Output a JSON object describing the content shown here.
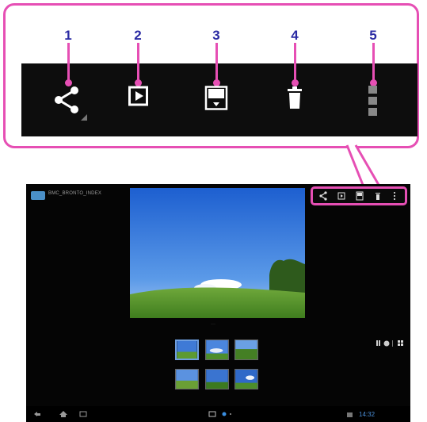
{
  "callout": {
    "numbers": [
      "1",
      "2",
      "3",
      "4",
      "5"
    ],
    "highlight_color": "#e64fb4",
    "number_color": "#2a2aa3"
  },
  "action_bar": {
    "icons": [
      "share-icon",
      "slideshow-play-icon",
      "display-select-icon",
      "delete-icon",
      "overflow-menu-icon"
    ]
  },
  "app": {
    "title": "BMC_BRONTO_INDEX",
    "logo_color": "#4a8fc7"
  },
  "thumbnails": {
    "count": 6,
    "selected_index": 0
  },
  "view_toggles": [
    "film-strip-icon",
    "pie-icon",
    "grid-icon"
  ],
  "status_bar": {
    "clock": "14:32",
    "accent": "#4a8fd8"
  },
  "nav_buttons": [
    "back-icon",
    "home-icon",
    "recent-apps-icon"
  ]
}
